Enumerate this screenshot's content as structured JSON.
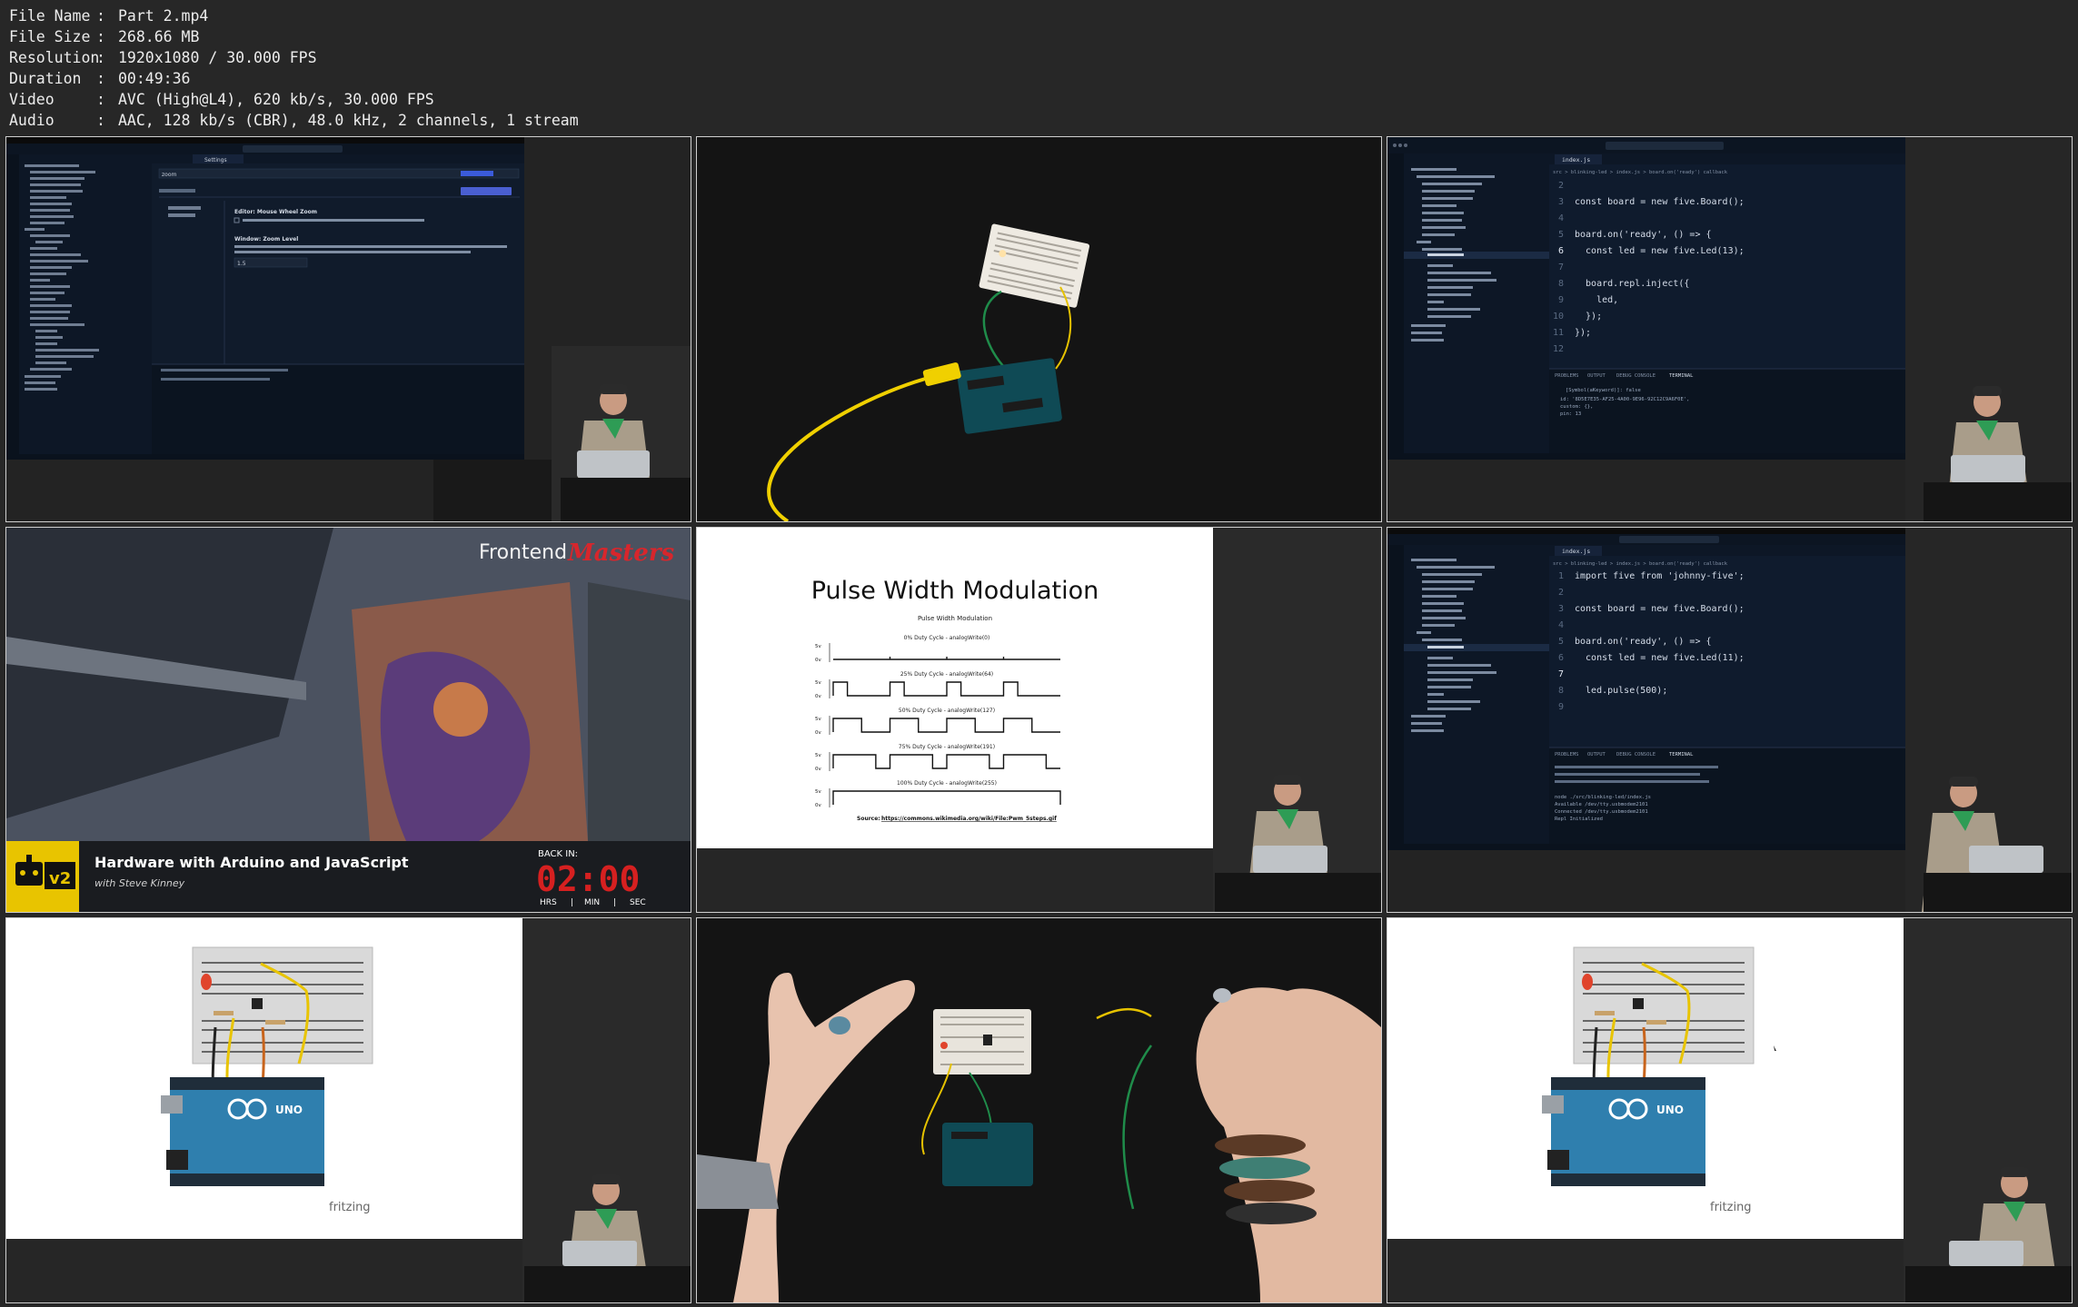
{
  "media_info": [
    {
      "key": "File Name",
      "value": "Part 2.mp4"
    },
    {
      "key": "File Size",
      "value": "268.66 MB"
    },
    {
      "key": "Resolution",
      "value": "1920x1080 / 30.000 FPS"
    },
    {
      "key": "Duration",
      "value": "00:49:36"
    },
    {
      "key": "Video",
      "value": "AVC (High@L4), 620 kb/s, 30.000 FPS"
    },
    {
      "key": "Audio",
      "value": "AAC, 128 kb/s (CBR), 48.0 kHz, 2 channels, 1 stream"
    }
  ],
  "colors": {
    "background": "#272727",
    "editor_bg": "#0f1b2d",
    "keyword": "#c58af9",
    "pwm_slide_bg": "#ffffff",
    "arduino_blue": "#2f7fae",
    "led_red": "#e0442c",
    "timer_red": "#d62020",
    "fm_red": "#d8262c"
  },
  "thumbs": {
    "t1": {
      "caption": "Settings editor: Window Zoom Level",
      "editor_tab": "Settings",
      "search_value": "zoom",
      "title_mouse_zoom": "Editor: Mouse Wheel Zoom",
      "title_zoom_level": "Window: Zoom Level",
      "zoom_value": "1.5"
    },
    "t2": {
      "caption": "Breadboard with LED and Arduino, yellow USB cable"
    },
    "t3": {
      "caption": "index.js - blinking-led",
      "tab": "index.js",
      "breadcrumb": "src > blinking-led > index.js > board.on('ready') callback",
      "code": [
        {
          "n": "2",
          "t": ""
        },
        {
          "n": "3",
          "t": "const board = new five.Board();"
        },
        {
          "n": "4",
          "t": ""
        },
        {
          "n": "5",
          "t": "board.on('ready', () => {"
        },
        {
          "n": "6",
          "t": "  const led = new five.Led(13);"
        },
        {
          "n": "7",
          "t": ""
        },
        {
          "n": "8",
          "t": "  board.repl.inject({"
        },
        {
          "n": "9",
          "t": "    led,"
        },
        {
          "n": "10",
          "t": "  });"
        },
        {
          "n": "11",
          "t": "});"
        },
        {
          "n": "12",
          "t": ""
        }
      ],
      "panel_tabs": [
        "PROBLEMS",
        "OUTPUT",
        "DEBUG CONSOLE",
        "TERMINAL"
      ],
      "terminal_lines": [
        "[Symbol(aKeyword)]: false",
        "id: '8D5E7E35-AF25-4A00-9E96-92C12C9A6F0E',",
        "custom: {},",
        "pin: 13"
      ]
    },
    "t4": {
      "brand_plain": "Frontend",
      "brand_script": "Masters",
      "course_title": "Hardware with Arduino and JavaScript",
      "instructor": "with Steve Kinney",
      "badge": "v2",
      "back_in_label": "BACK IN:",
      "timer_value": "02:00",
      "timer_units": [
        "HRS",
        "MIN",
        "SEC"
      ]
    },
    "t5": {
      "slide_title": "Pulse Width Modulation",
      "chart_title": "Pulse Width Modulation",
      "source_label": "Source:",
      "source_url": "https://commons.wikimedia.org/wiki/File:Pwm_5steps.gif"
    },
    "t6": {
      "caption": "index.js - nodebots-v2",
      "tab": "index.js",
      "breadcrumb": "src > blinking-led > index.js > board.on('ready') callback",
      "code": [
        {
          "n": "1",
          "t": "import five from 'johnny-five';"
        },
        {
          "n": "2",
          "t": ""
        },
        {
          "n": "3",
          "t": "const board = new five.Board();"
        },
        {
          "n": "4",
          "t": ""
        },
        {
          "n": "5",
          "t": "board.on('ready', () => {"
        },
        {
          "n": "6",
          "t": "  const led = new five.Led(11);"
        },
        {
          "n": "7",
          "t": ""
        },
        {
          "n": "8",
          "t": "  led.pulse(500);"
        },
        {
          "n": "9",
          "t": ""
        }
      ],
      "terminal_lines": [
        "node ./src/blinking-led/index.js",
        "Available /dev/tty.usbmodem2101",
        "Connected /dev/tty.usbmodem2101",
        "Repl Initialized"
      ]
    },
    "t7": {
      "caption": "Fritzing diagram: LED, button and Arduino UNO",
      "fritzing_label": "fritzing",
      "board_label": "UNO"
    },
    "t8": {
      "caption": "Hands wiring a breadboard circuit"
    },
    "t9": {
      "caption": "Fritzing diagram: LED, button and Arduino UNO",
      "fritzing_label": "fritzing",
      "board_label": "UNO"
    }
  },
  "chart_data": {
    "type": "line",
    "title": "Pulse Width Modulation",
    "y_tick_labels": [
      "5v",
      "0v"
    ],
    "series": [
      {
        "name": "0% Duty Cycle - analogWrite(0)",
        "duty_cycle": 0
      },
      {
        "name": "25% Duty Cycle - analogWrite(64)",
        "duty_cycle": 0.25
      },
      {
        "name": "50% Duty Cycle - analogWrite(127)",
        "duty_cycle": 0.5
      },
      {
        "name": "75% Duty Cycle - analogWrite(191)",
        "duty_cycle": 0.75
      },
      {
        "name": "100% Duty Cycle - analogWrite(255)",
        "duty_cycle": 1
      }
    ]
  }
}
